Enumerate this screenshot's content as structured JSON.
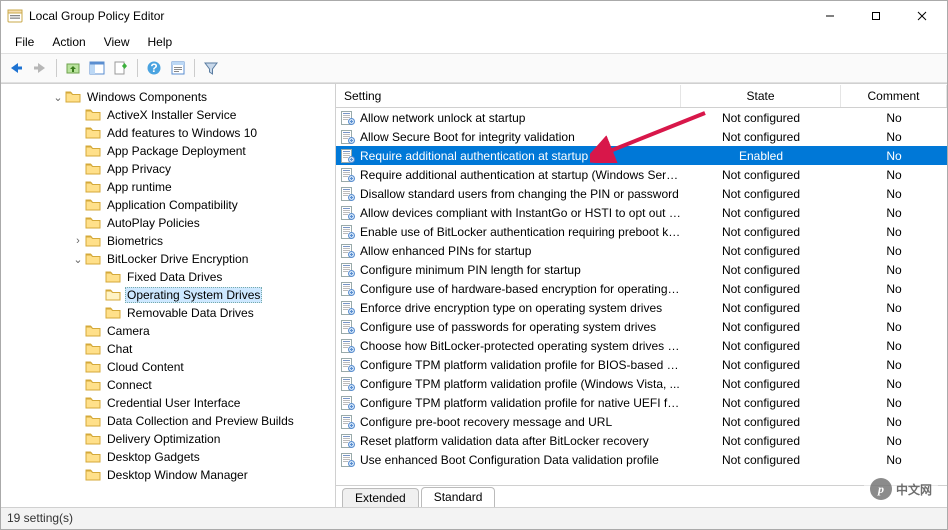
{
  "title": "Local Group Policy Editor",
  "menu": {
    "file": "File",
    "action": "Action",
    "view": "View",
    "help": "Help"
  },
  "cols": {
    "setting": "Setting",
    "state": "State",
    "comment": "Comment"
  },
  "tabs": {
    "extended": "Extended",
    "standard": "Standard"
  },
  "status": "19 setting(s)",
  "tree": {
    "root": "Windows Components",
    "sel": "Operating System Drives",
    "items": [
      "ActiveX Installer Service",
      "Add features to Windows 10",
      "App Package Deployment",
      "App Privacy",
      "App runtime",
      "Application Compatibility",
      "AutoPlay Policies",
      "Biometrics",
      "BitLocker Drive Encryption",
      "Fixed Data Drives",
      "Operating System Drives",
      "Removable Data Drives",
      "Camera",
      "Chat",
      "Cloud Content",
      "Connect",
      "Credential User Interface",
      "Data Collection and Preview Builds",
      "Delivery Optimization",
      "Desktop Gadgets",
      "Desktop Window Manager"
    ]
  },
  "settings": [
    {
      "t": "Allow network unlock at startup",
      "s": "Not configured",
      "c": "No"
    },
    {
      "t": "Allow Secure Boot for integrity validation",
      "s": "Not configured",
      "c": "No"
    },
    {
      "t": "Require additional authentication at startup",
      "s": "Enabled",
      "c": "No",
      "sel": true
    },
    {
      "t": "Require additional authentication at startup (Windows Serve...",
      "s": "Not configured",
      "c": "No"
    },
    {
      "t": "Disallow standard users from changing the PIN or password",
      "s": "Not configured",
      "c": "No"
    },
    {
      "t": "Allow devices compliant with InstantGo or HSTI to opt out o...",
      "s": "Not configured",
      "c": "No"
    },
    {
      "t": "Enable use of BitLocker authentication requiring preboot ke...",
      "s": "Not configured",
      "c": "No"
    },
    {
      "t": "Allow enhanced PINs for startup",
      "s": "Not configured",
      "c": "No"
    },
    {
      "t": "Configure minimum PIN length for startup",
      "s": "Not configured",
      "c": "No"
    },
    {
      "t": "Configure use of hardware-based encryption for operating s...",
      "s": "Not configured",
      "c": "No"
    },
    {
      "t": "Enforce drive encryption type on operating system drives",
      "s": "Not configured",
      "c": "No"
    },
    {
      "t": "Configure use of passwords for operating system drives",
      "s": "Not configured",
      "c": "No"
    },
    {
      "t": "Choose how BitLocker-protected operating system drives ca...",
      "s": "Not configured",
      "c": "No"
    },
    {
      "t": "Configure TPM platform validation profile for BIOS-based fir...",
      "s": "Not configured",
      "c": "No"
    },
    {
      "t": "Configure TPM platform validation profile (Windows Vista, ...",
      "s": "Not configured",
      "c": "No"
    },
    {
      "t": "Configure TPM platform validation profile for native UEFI fir...",
      "s": "Not configured",
      "c": "No"
    },
    {
      "t": "Configure pre-boot recovery message and URL",
      "s": "Not configured",
      "c": "No"
    },
    {
      "t": "Reset platform validation data after BitLocker recovery",
      "s": "Not configured",
      "c": "No"
    },
    {
      "t": "Use enhanced Boot Configuration Data validation profile",
      "s": "Not configured",
      "c": "No"
    }
  ],
  "watermark": "中文网"
}
